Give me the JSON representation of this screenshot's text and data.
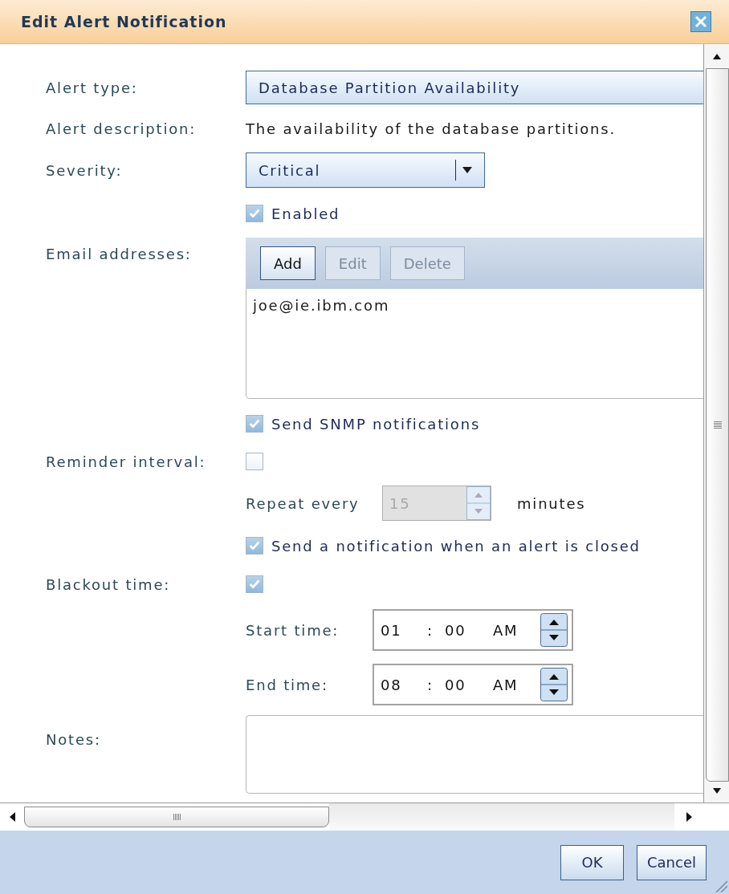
{
  "dialog": {
    "title": "Edit Alert Notification"
  },
  "form": {
    "alert_type": {
      "label": "Alert type:",
      "value": "Database Partition Availability"
    },
    "alert_description": {
      "label": "Alert description:",
      "value": "The availability of the database partitions."
    },
    "severity": {
      "label": "Severity:",
      "value": "Critical"
    },
    "enabled": {
      "label": "Enabled",
      "checked": true
    },
    "email_addresses": {
      "label": "Email addresses:",
      "buttons": [
        {
          "label": "Add",
          "disabled": false
        },
        {
          "label": "Edit",
          "disabled": true
        },
        {
          "label": "Delete",
          "disabled": true
        }
      ],
      "items": [
        "joe@ie.ibm.com"
      ]
    },
    "snmp": {
      "label": "Send SNMP notifications",
      "checked": true
    },
    "reminder_interval": {
      "label": "Reminder interval:",
      "checked": false,
      "repeat_label": "Repeat every",
      "value": "15",
      "disabled": true,
      "unit": "minutes"
    },
    "notify_closed": {
      "label": "Send a notification when an alert is closed",
      "checked": true
    },
    "blackout_time": {
      "label": "Blackout time:",
      "checked": true,
      "times": [
        {
          "label": "Start time:",
          "hour": "01",
          "separator": ":",
          "minute": "00",
          "period": "AM"
        },
        {
          "label": "End time:",
          "hour": "08",
          "separator": ":",
          "minute": "00",
          "period": "AM"
        }
      ]
    },
    "notes": {
      "label": "Notes:"
    }
  },
  "buttons": [
    {
      "label": "OK"
    },
    {
      "label": "Cancel"
    }
  ]
}
